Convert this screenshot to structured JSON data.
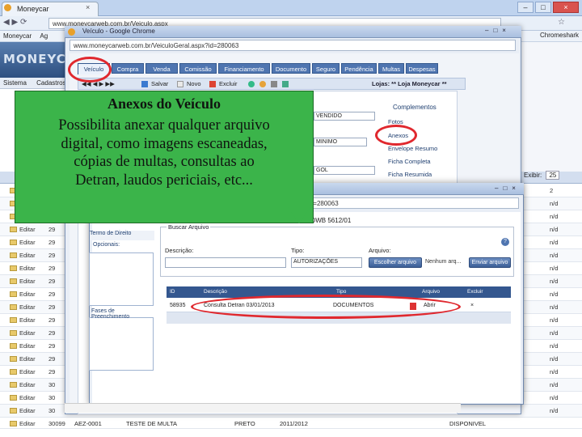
{
  "outer_browser": {
    "tab_title": "Moneycar",
    "url": "www.moneycarweb.com.br/Veiculo.aspx",
    "bookmarks": [
      "Moneycar",
      "Ag"
    ],
    "bookmarks_right": "Chromeshark"
  },
  "app": {
    "logo": "MONEYCAR",
    "menu": [
      "Sistema",
      "Cadastros"
    ]
  },
  "vehicle_window": {
    "title": "Veículo - Google Chrome",
    "url": "www.moneycarweb.com.br/VeiculoGeral.aspx?id=280063",
    "tabs": [
      "Veículo",
      "Compra",
      "Venda",
      "Comissão",
      "Financiamento",
      "Documento",
      "Seguro",
      "Pendência",
      "Multas",
      "Despesas"
    ],
    "toolbar": {
      "save": "Salvar",
      "new": "Novo",
      "delete": "Excluir"
    },
    "login": "Lojas: ** Loja Moneycar **",
    "sidebar_title": "Complementos",
    "sidebar_links": [
      "Fotos",
      "Anexos",
      "Envelope Resumo",
      "Ficha Completa",
      "Ficha Resumida"
    ],
    "fields": [
      "VENDIDO",
      "MINIMO",
      "GOL"
    ],
    "panel1_title": "Termo de Direito",
    "panel1_label": "Opcionais:",
    "panel2_title": "Fases de Preenchimento"
  },
  "callout": {
    "title": "Anexos do Veículo",
    "lines": [
      "Possibilita anexar qualquer arquivo",
      "digital, como imagens escaneadas,",
      "cópias de multas, consultas ao",
      "Detran, laudos periciais, etc..."
    ]
  },
  "attach_window": {
    "url": "www.moneycarweb.com.br/Anexo.aspx?id=280063",
    "plate": "Placa: DWB 5612/01",
    "legend": "Buscar Arquivo",
    "desc_label": "Descrição:",
    "type_label": "Tipo:",
    "type_value": "AUTORIZAÇÕES",
    "file_label": "Arquivo:",
    "choose_button": "Escolher arquivo",
    "no_file": "Nenhum arq...",
    "send_button": "Enviar arquivo",
    "grid_headers": [
      "ID",
      "Descrição",
      "Tipo",
      "Arquivo",
      "Excluir"
    ],
    "grid_row": {
      "id": "58935",
      "desc": "Consulta Detran 03/01/2013",
      "type": "DOCUMENTOS",
      "file": "Abrir",
      "delete": "×"
    }
  },
  "background_table": {
    "edit_label": "Editar",
    "pager_label": "Exibir:",
    "pager_value": "25",
    "ids": [
      "29",
      "29",
      "29",
      "29",
      "29",
      "29",
      "29",
      "29",
      "29",
      "29",
      "29",
      "29",
      "29",
      "29",
      "29",
      "30",
      "30",
      "30"
    ],
    "right_col": [
      "2",
      "n/d",
      "n/d",
      "n/d",
      "n/d",
      "n/d",
      "n/d",
      "n/d",
      "n/d",
      "n/d",
      "n/d",
      "n/d",
      "n/d",
      "n/d",
      "n/d",
      "n/d",
      "n/d",
      "n/d"
    ],
    "last_row": {
      "id": "30099",
      "plate": "AEZ-0001",
      "model": "TESTE DE MULTA",
      "color": "PRETO",
      "year": "2011/2012",
      "status": "DISPONIVEL"
    }
  },
  "colors": {
    "callout": "#3bb44a",
    "highlight": "#e0282e",
    "tab_blue": "#4f75b0"
  }
}
